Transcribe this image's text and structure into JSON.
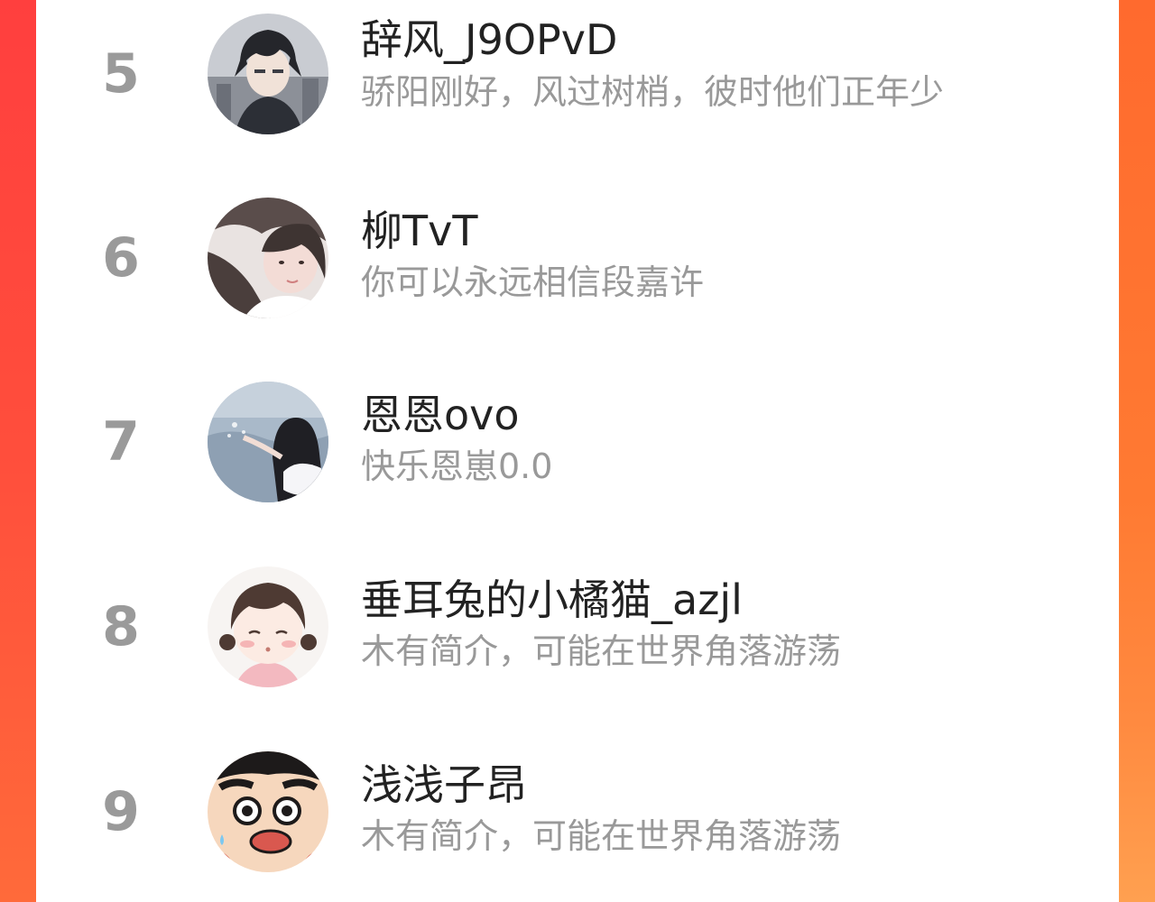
{
  "users": [
    {
      "rank": "5",
      "name": "辞风_J9OPvD",
      "bio": "骄阳刚好，风过树梢，彼时他们正年少",
      "avatar_icon": "anime-boy-avatar-icon"
    },
    {
      "rank": "6",
      "name": "柳TvT",
      "bio": "你可以永远相信段嘉许",
      "avatar_icon": "girl-photo-avatar-icon"
    },
    {
      "rank": "7",
      "name": "恩恩ovo",
      "bio": "快乐恩崽0.0",
      "avatar_icon": "girl-by-water-avatar-icon"
    },
    {
      "rank": "8",
      "name": "垂耳兔的小橘猫_azjl",
      "bio": "木有简介，可能在世界角落游荡",
      "avatar_icon": "cartoon-girl-avatar-icon"
    },
    {
      "rank": "9",
      "name": "浅浅子昂",
      "bio": "木有简介，可能在世界角落游荡",
      "avatar_icon": "crayon-shin-chan-avatar-icon"
    }
  ],
  "colors": {
    "background_accent": "#ff5a3a",
    "rank_text": "#9a9a9a",
    "name_text": "#222222",
    "bio_text": "#999999"
  }
}
